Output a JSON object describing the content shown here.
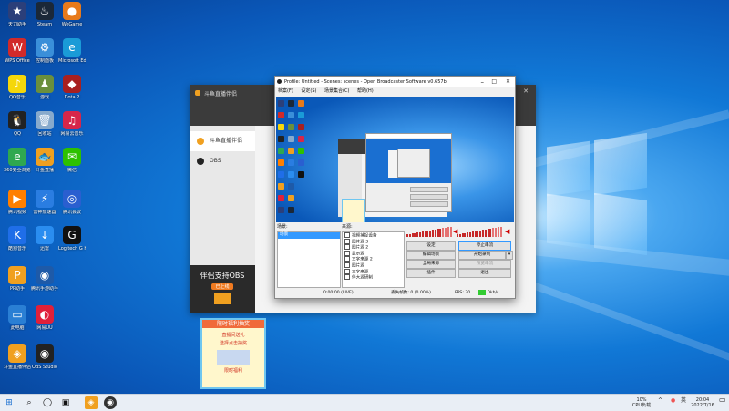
{
  "desktop_icons": [
    {
      "label": "天刀助手",
      "color": "#2b3f7a",
      "glyph": "★"
    },
    {
      "label": "Steam",
      "color": "#1b2838",
      "glyph": "♨"
    },
    {
      "label": "WeGame",
      "color": "#e87a1a",
      "glyph": "●"
    },
    {
      "label": "WPS Office",
      "color": "#d12a2a",
      "glyph": "W"
    },
    {
      "label": "控制面板",
      "color": "#3a8fd9",
      "glyph": "⚙"
    },
    {
      "label": "Microsoft Edge",
      "color": "#1a9bd7",
      "glyph": "e"
    },
    {
      "label": "QQ音乐",
      "color": "#f5d70a",
      "glyph": "♪"
    },
    {
      "label": "游戏",
      "color": "#6a8f3d",
      "glyph": "♟"
    },
    {
      "label": "Dota 2",
      "color": "#a82020",
      "glyph": "◆"
    },
    {
      "label": "QQ",
      "color": "#222222",
      "glyph": "🐧"
    },
    {
      "label": "回收站",
      "color": "#88aacc",
      "glyph": "🗑"
    },
    {
      "label": "网易云音乐",
      "color": "#d7264a",
      "glyph": "♫"
    },
    {
      "label": "360安全浏览器",
      "color": "#2fa84f",
      "glyph": "e"
    },
    {
      "label": "斗鱼直播",
      "color": "#f0a020",
      "glyph": "🐟"
    },
    {
      "label": "微信",
      "color": "#2dc100",
      "glyph": "✉"
    },
    {
      "label": "腾讯视频",
      "color": "#ff7f00",
      "glyph": "▶"
    },
    {
      "label": "雷神加速器",
      "color": "#2a7de1",
      "glyph": "⚡"
    },
    {
      "label": "腾讯会议",
      "color": "#2a5fd0",
      "glyph": "◎"
    },
    {
      "label": "酷狗音乐",
      "color": "#1f6ee8",
      "glyph": "K"
    },
    {
      "label": "迅雷",
      "color": "#2a8df0",
      "glyph": "↓"
    },
    {
      "label": "Logitech G HUB",
      "color": "#111111",
      "glyph": "G"
    },
    {
      "label": "PP助手",
      "color": "#f0a020",
      "glyph": "P"
    },
    {
      "label": "腾讯手游助手",
      "color": "#1e5aa8",
      "glyph": "◉"
    },
    {
      "label": "此电脑",
      "color": "#2a7fd4",
      "glyph": "▭"
    },
    {
      "label": "网易UU",
      "color": "#e0203a",
      "glyph": "◐"
    },
    {
      "label": "斗鱼直播伴侣",
      "color": "#f0a020",
      "glyph": "◈"
    },
    {
      "label": "OBS Studio",
      "color": "#222222",
      "glyph": "◉"
    }
  ],
  "douyu": {
    "title": "斗鱼直播伴侣",
    "side_items": [
      "斗鱼直播伴侣",
      "OBS"
    ],
    "banner_line1": "伴侣支持OBS",
    "banner_line2": "已上线"
  },
  "obs": {
    "title": "Profile: Untitled - Scenes: scenes - Open Broadcaster Software v0.657b",
    "menu": [
      "档案(F)",
      "设定(S)",
      "场景集合(C)",
      "帮助(H)"
    ],
    "scenes_label": "场景:",
    "sources_label": "来源:",
    "scenes": [
      "场景"
    ],
    "sources": [
      "视频捕捉设备",
      "图片源 3",
      "图片源 2",
      "显示源",
      "文字来源 2",
      "图片源",
      "文字来源",
      "伴大源研制"
    ],
    "buttons": {
      "settings": "设定",
      "stop_stream": "停止串流",
      "edit_scene": "编辑场景",
      "start_record": "开始录制",
      "global_sources": "全局来源",
      "preview": "预览串流",
      "plugins": "插件",
      "exit": "退出"
    },
    "status": {
      "time": "0:00:00 (LIVE)",
      "dropped": "丢失帧数: 0 (0.00%)",
      "fps": "FPS: 30",
      "bitrate": "0kb/s"
    }
  },
  "ad": {
    "line1": "限时福利抽奖",
    "line2": "直播间送礼",
    "line3": "选择点击抽奖",
    "footer": "限时福利"
  },
  "taskbar": {
    "start": "⊞",
    "tray_cpu_value": "10%",
    "tray_cpu_label": "CPU负载",
    "time": "20:04",
    "date": "2022/7/16",
    "lang": "英"
  }
}
